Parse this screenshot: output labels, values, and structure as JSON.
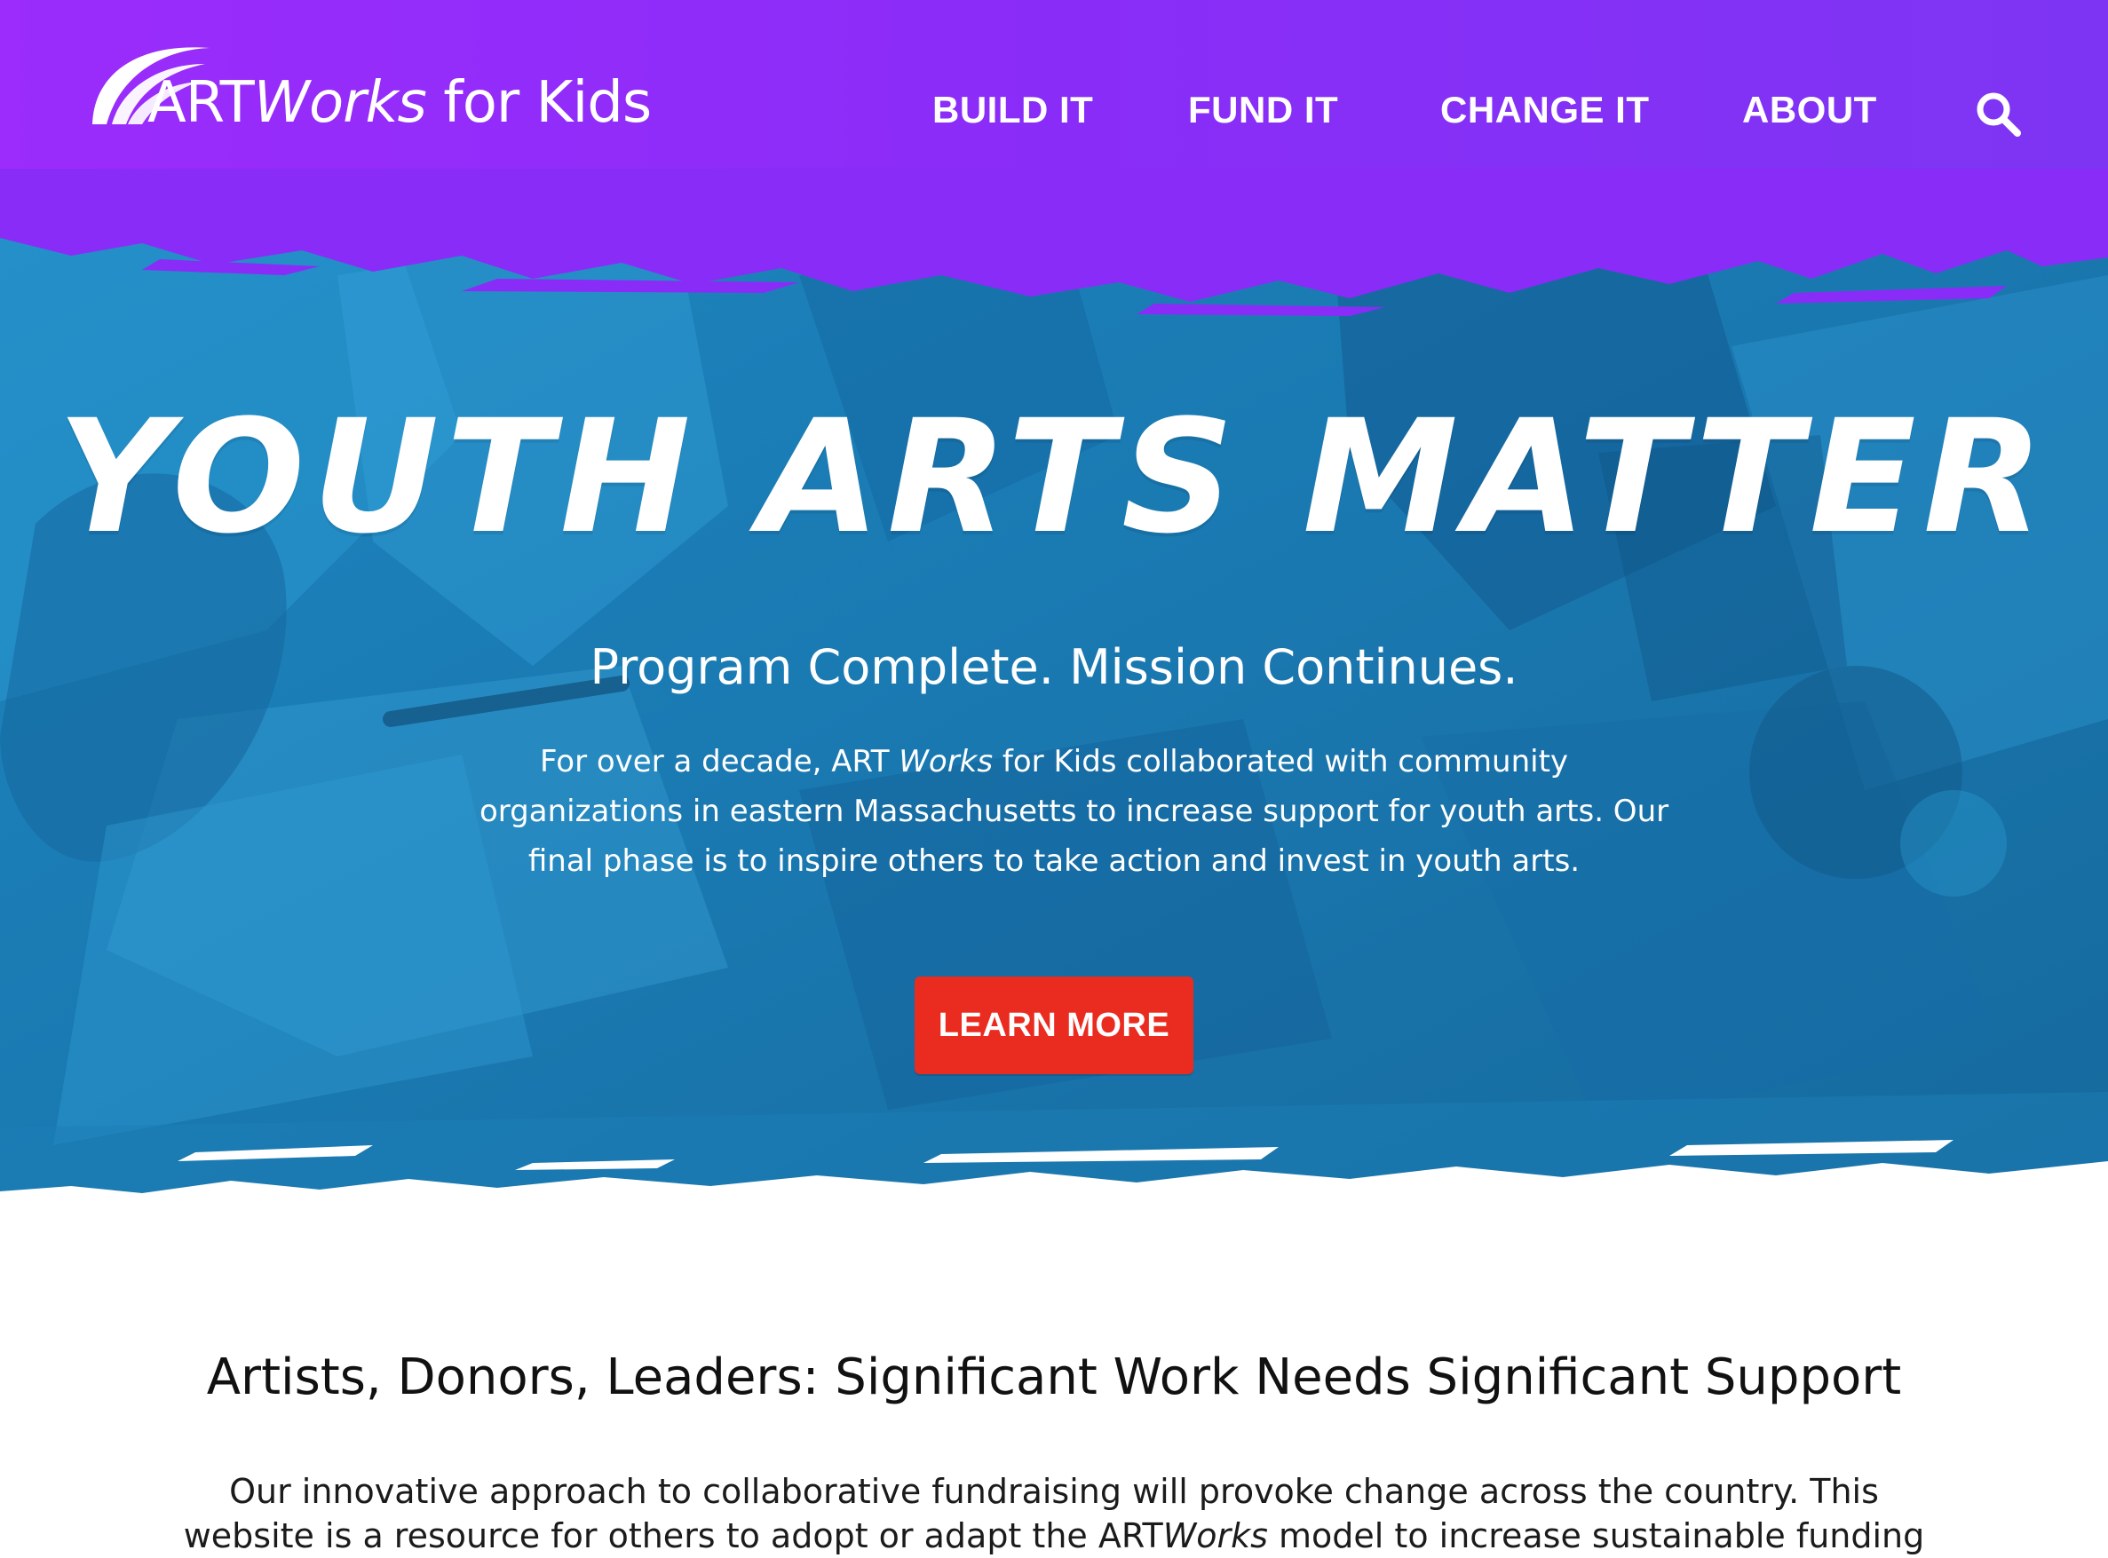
{
  "header": {
    "logo": {
      "art": "ART",
      "works": "Works",
      "rest": " for Kids"
    },
    "nav": [
      {
        "label": "BUILD IT"
      },
      {
        "label": "FUND IT"
      },
      {
        "label": "CHANGE IT"
      },
      {
        "label": "ABOUT"
      }
    ],
    "search_icon": "search-icon"
  },
  "hero": {
    "title": "YOUTH ARTS MATTER",
    "subtitle": "Program Complete. Mission Continues.",
    "body": {
      "line1_a": "For over a decade, ART ",
      "line1_works": "Works",
      "line1_b": " for Kids collaborated with community",
      "line2": "organizations in eastern Massachusetts to increase support for youth arts. Our",
      "line3": "final phase is to inspire others to take action and invest in youth arts."
    },
    "cta": "LEARN MORE"
  },
  "section": {
    "title": "Artists, Donors, Leaders: Significant Work Needs Significant Support",
    "body": {
      "line1": "Our innovative approach to collaborative fundraising will provoke change across the country. This",
      "line2_a": "website is a resource for others to adopt or adapt the ART",
      "line2_works": "Works",
      "line2_b": " model to increase sustainable funding"
    }
  },
  "colors": {
    "header_purple": "#8a2cf8",
    "hero_blue": "#1a7fb8",
    "cta_red": "#ea2b1f",
    "text_dark": "#111111"
  }
}
